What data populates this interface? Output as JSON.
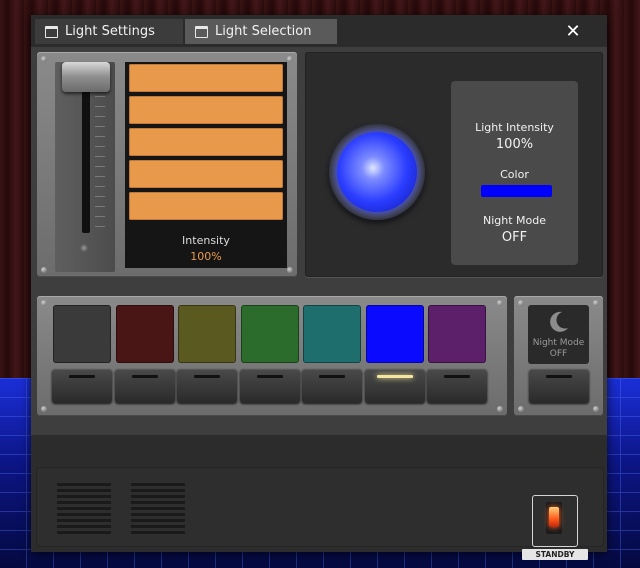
{
  "tabs": [
    {
      "label": "Light Settings",
      "icon": "window-icon",
      "active": false
    },
    {
      "label": "Light Selection",
      "icon": "window-icon",
      "active": true
    }
  ],
  "close_label": "✕",
  "intensity_panel": {
    "slider_level": 1.0,
    "bar_count": 5,
    "label": "Intensity",
    "value": "100%"
  },
  "light_preview": {
    "bulb_color": "#2a3cff",
    "light_intensity_label": "Light Intensity",
    "light_intensity_value": "100%",
    "color_label": "Color",
    "color_value": "#0000ff",
    "night_mode_label": "Night Mode",
    "night_mode_value": "OFF"
  },
  "color_pads": [
    {
      "color": "#3a3a3a",
      "selected": false
    },
    {
      "color": "#4a1515",
      "selected": false
    },
    {
      "color": "#5a5a20",
      "selected": false
    },
    {
      "color": "#2b6b2b",
      "selected": false
    },
    {
      "color": "#1f6e6e",
      "selected": false
    },
    {
      "color": "#0a0aff",
      "selected": true
    },
    {
      "color": "#5c1f6a",
      "selected": false
    }
  ],
  "night_mode_button": {
    "icon": "moon-icon",
    "label": "Night Mode",
    "state": "OFF"
  },
  "standby": {
    "label": "STANDBY"
  },
  "colors": {
    "accent_orange": "#e89a4a",
    "panel_dark": "#2d2d2d",
    "panel_metal": "#7a7a7a"
  }
}
